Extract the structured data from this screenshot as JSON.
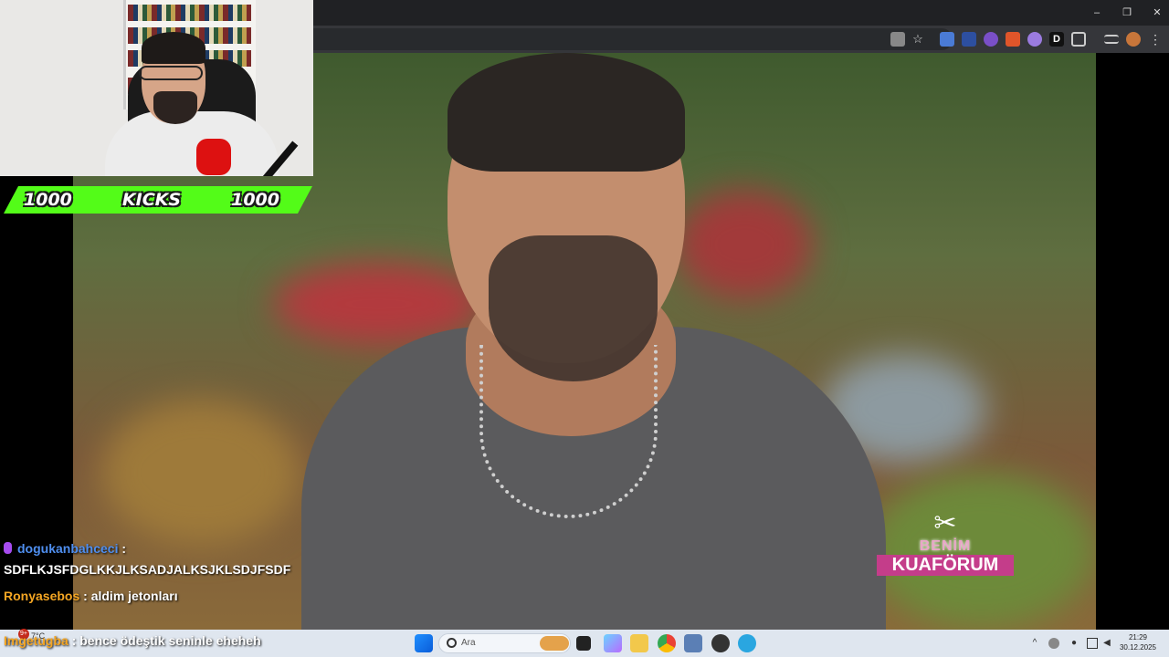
{
  "webcam_overlay": {
    "kicks_left": "1000",
    "kicks_label": "KICKS",
    "kicks_right": "1000"
  },
  "chat": [
    {
      "user": "dogukanbahceci",
      "sep": " :",
      "text": "SDFLKJSFDGLKKJLKSADJALKSJKLSDJFSDF",
      "badge": "mic-icon"
    },
    {
      "user": "Ronyasebos",
      "sep": " : ",
      "text": "aldim jetonları"
    },
    {
      "user": "Imgetugba",
      "sep": " : ",
      "text": "bence ödeştik seninle eheheh"
    }
  ],
  "video_logo": {
    "line1": "BENİM",
    "line2": "KUAFÖRUM"
  },
  "taskbar": {
    "search_placeholder": "Ara",
    "weather_badge": "9+",
    "weather_temp": "7°C",
    "clock_time": "21:29",
    "clock_date": "30.12.2025"
  },
  "colors": {
    "kicks_green": "#53fc18",
    "chat_name_blue": "#4f8ff0",
    "chat_name_orange": "#f5a623"
  }
}
